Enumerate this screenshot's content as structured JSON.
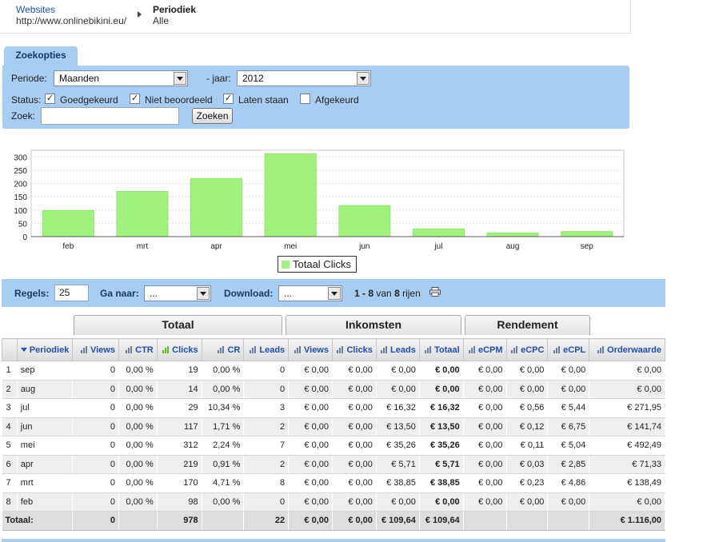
{
  "breadcrumb": {
    "site_label": "Websites",
    "site_value": "http://www.onlinebikini.eu/",
    "period_label": "Periodiek",
    "period_value": "Alle"
  },
  "search": {
    "tab_label": "Zoekopties",
    "periode_label": "Periode:",
    "periode_value": "Maanden",
    "jaar_label": "- jaar:",
    "jaar_value": "2012",
    "status_label": "Status:",
    "statuses": [
      {
        "label": "Goedgekeurd",
        "checked": true
      },
      {
        "label": "Niet beoordeeld",
        "checked": true
      },
      {
        "label": "Laten staan",
        "checked": true
      },
      {
        "label": "Afgekeurd",
        "checked": false
      }
    ],
    "zoek_label": "Zoek:",
    "zoek_value": "",
    "button_label": "Zoeken"
  },
  "chart_data": {
    "type": "bar",
    "categories": [
      "feb",
      "mrt",
      "apr",
      "mei",
      "jun",
      "jul",
      "aug",
      "sep"
    ],
    "series": [
      {
        "name": "Totaal Clicks",
        "values": [
          98,
          170,
          219,
          312,
          117,
          29,
          14,
          19
        ]
      }
    ],
    "yticks": [
      "0",
      "50",
      "100",
      "150",
      "200",
      "250",
      "300"
    ],
    "ylim": [
      0,
      325
    ],
    "grid": true,
    "legend": "bottom-center",
    "bar_color": "#a0f27c"
  },
  "nav": {
    "regels_label": "Regels:",
    "regels_value": "25",
    "ganaar_label": "Ga naar:",
    "ganaar_value": "...",
    "download_label": "Download:",
    "download_value": "...",
    "count_bold": "1 - 8",
    "count_rest": "van",
    "count_total": "8",
    "count_suffix": "rijen"
  },
  "groups": {
    "totaal": "Totaal",
    "inkomsten": "Inkomsten",
    "rendement": "Rendement"
  },
  "table": {
    "headers": [
      "Periodiek",
      "Views",
      "CTR",
      "Clicks",
      "CR",
      "Leads",
      "Views",
      "Clicks",
      "Leads",
      "Totaal",
      "eCPM",
      "eCPC",
      "eCPL",
      "Orderwaarde"
    ],
    "rows": [
      [
        "1",
        "sep",
        "0",
        "0,00 %",
        "19",
        "0,00 %",
        "0",
        "€ 0,00",
        "€ 0,00",
        "€ 0,00",
        "€ 0,00",
        "€ 0,00",
        "€ 0,00",
        "€ 0,00",
        "€ 0,00"
      ],
      [
        "2",
        "aug",
        "0",
        "0,00 %",
        "14",
        "0,00 %",
        "0",
        "€ 0,00",
        "€ 0,00",
        "€ 0,00",
        "€ 0,00",
        "€ 0,00",
        "€ 0,00",
        "€ 0,00",
        "€ 0,00"
      ],
      [
        "3",
        "jul",
        "0",
        "0,00 %",
        "29",
        "10,34 %",
        "3",
        "€ 0,00",
        "€ 0,00",
        "€ 16,32",
        "€ 16,32",
        "€ 0,00",
        "€ 0,56",
        "€ 5,44",
        "€ 271,95"
      ],
      [
        "4",
        "jun",
        "0",
        "0,00 %",
        "117",
        "1,71 %",
        "2",
        "€ 0,00",
        "€ 0,00",
        "€ 13,50",
        "€ 13,50",
        "€ 0,00",
        "€ 0,12",
        "€ 6,75",
        "€ 141,74"
      ],
      [
        "5",
        "mei",
        "0",
        "0,00 %",
        "312",
        "2,24 %",
        "7",
        "€ 0,00",
        "€ 0,00",
        "€ 35,26",
        "€ 35,26",
        "€ 0,00",
        "€ 0,11",
        "€ 5,04",
        "€ 492,49"
      ],
      [
        "6",
        "apr",
        "0",
        "0,00 %",
        "219",
        "0,91 %",
        "2",
        "€ 0,00",
        "€ 0,00",
        "€ 5,71",
        "€ 5,71",
        "€ 0,00",
        "€ 0,03",
        "€ 2,85",
        "€ 71,33"
      ],
      [
        "7",
        "mrt",
        "0",
        "0,00 %",
        "170",
        "4,71 %",
        "8",
        "€ 0,00",
        "€ 0,00",
        "€ 38,85",
        "€ 38,85",
        "€ 0,00",
        "€ 0,23",
        "€ 4,86",
        "€ 138,49"
      ],
      [
        "8",
        "feb",
        "0",
        "0,00 %",
        "98",
        "0,00 %",
        "0",
        "€ 0,00",
        "€ 0,00",
        "€ 0,00",
        "€ 0,00",
        "€ 0,00",
        "€ 0,00",
        "€ 0,00",
        "€ 0,00"
      ]
    ],
    "total": [
      "Totaal:",
      "0",
      "",
      "978",
      "",
      "22",
      "€ 0,00",
      "€ 0,00",
      "€ 109,64",
      "€ 109,64",
      "",
      "",
      "",
      "€ 1.116,00"
    ]
  }
}
